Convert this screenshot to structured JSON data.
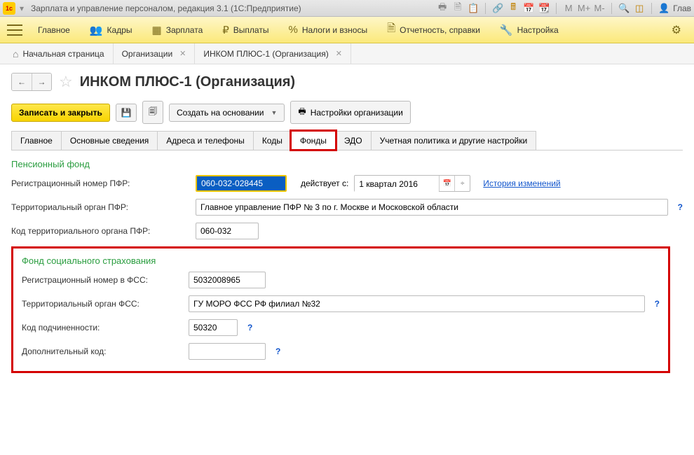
{
  "titlebar": {
    "app_title": "Зарплата и управление персоналом, редакция 3.1  (1С:Предприятие)",
    "user_label": "Глав"
  },
  "mainmenu": {
    "items": [
      {
        "icon": "≡",
        "label": "Главное"
      },
      {
        "icon": "👥",
        "label": "Кадры"
      },
      {
        "icon": "▦",
        "label": "Зарплата"
      },
      {
        "icon": "₽",
        "label": "Выплаты"
      },
      {
        "icon": "%",
        "label": "Налоги и взносы"
      },
      {
        "icon": "🗎",
        "label": "Отчетность, справки"
      },
      {
        "icon": "🔧",
        "label": "Настройка"
      }
    ]
  },
  "tabs": [
    {
      "label": "Начальная страница",
      "home": true,
      "closable": false
    },
    {
      "label": "Организации",
      "closable": true
    },
    {
      "label": "ИНКОМ ПЛЮС-1 (Организация)",
      "closable": true
    }
  ],
  "page": {
    "title": "ИНКОМ ПЛЮС-1 (Организация)"
  },
  "toolbar": {
    "save_close": "Записать и закрыть",
    "create_on": "Создать на основании",
    "org_settings": "Настройки организации"
  },
  "subtabs": [
    "Главное",
    "Основные сведения",
    "Адреса и телефоны",
    "Коды",
    "Фонды",
    "ЭДО",
    "Учетная политика и другие настройки"
  ],
  "pfr": {
    "section": "Пенсионный фонд",
    "reg_label": "Регистрационный номер ПФР:",
    "reg_value": "060-032-028445",
    "since_label": "действует с:",
    "since_value": "1 квартал 2016",
    "history_link": "История изменений",
    "territory_label": "Территориальный орган ПФР:",
    "territory_value": "Главное управление ПФР № 3 по г. Москве и Московской области",
    "code_label": "Код территориального органа ПФР:",
    "code_value": "060-032"
  },
  "fss": {
    "section": "Фонд социального страхования",
    "reg_label": "Регистрационный номер в ФСС:",
    "reg_value": "5032008965",
    "territory_label": "Территориальный орган ФСС:",
    "territory_value": "ГУ МОРО ФСС РФ филиал №32",
    "sub_code_label": "Код подчиненности:",
    "sub_code_value": "50320",
    "add_code_label": "Дополнительный код:",
    "add_code_value": ""
  }
}
